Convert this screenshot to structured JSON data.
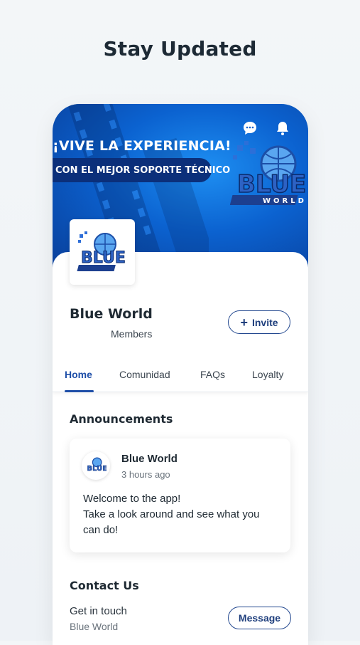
{
  "header": {
    "title": "Stay Updated"
  },
  "banner": {
    "headline": "¡VIVE LA EXPERIENCIA!",
    "subheadline": "CON EL MEJOR SOPORTE TÉCNICO",
    "logo_text": "BLUE",
    "logo_subtext": "WORLD"
  },
  "top_icons": [
    "chat-icon",
    "bell-icon"
  ],
  "group": {
    "name": "Blue World",
    "members_label": "Members",
    "invite_label": "Invite"
  },
  "tabs": [
    {
      "label": "Home",
      "active": true
    },
    {
      "label": "Comunidad",
      "active": false
    },
    {
      "label": "FAQs",
      "active": false
    },
    {
      "label": "Loyalty",
      "active": false
    }
  ],
  "announcements": {
    "title": "Announcements",
    "post": {
      "author": "Blue World",
      "time": "3 hours ago",
      "lines": [
        "Welcome to the app!",
        "Take a look around and see what you",
        "can do!"
      ]
    }
  },
  "contact": {
    "title": "Contact Us",
    "subtitle": "Get in touch",
    "org": "Blue World",
    "message_label": "Message"
  },
  "colors": {
    "accent": "#1f4fa8",
    "banner_blue": "#0b62d0"
  }
}
